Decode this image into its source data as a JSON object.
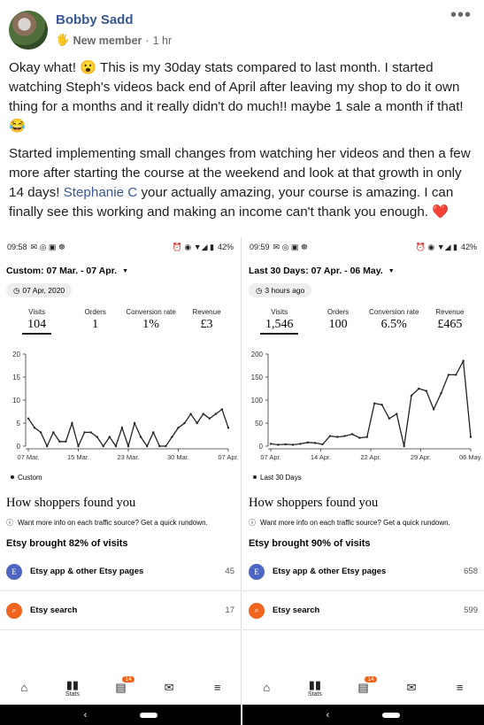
{
  "post": {
    "author": "Bobby Sadd",
    "badge": "New member",
    "separator": "·",
    "time": "1 hr",
    "paragraph1": "Okay what! 😮 This is my 30day stats compared to last month. I started watching Steph's videos back end of April after leaving my shop to do it own thing for a months and it really didn't do much!! maybe 1 sale a month if that! 😂",
    "paragraph2_a": "Started implementing small changes from watching her videos and then a few more after starting the course at the weekend and look at that growth in only 14 days! ",
    "mention": "Stephanie C",
    "paragraph2_b": " your actually amazing, your course is amazing. I can finally see this working and making an income can't thank you enough. ❤️"
  },
  "screens": [
    {
      "status": {
        "time": "09:58",
        "icons_left": "✉ ◎ ▣ ☸",
        "icons_right": "⏰ ◉ ▼◢ ▮",
        "battery": "42%"
      },
      "range": "Custom: 07 Mar. - 07 Apr.",
      "date_pill": "07 Apr, 2020",
      "metrics": [
        {
          "label": "Visits",
          "value": "104"
        },
        {
          "label": "Orders",
          "value": "1"
        },
        {
          "label": "Conversion rate",
          "value": "1%"
        },
        {
          "label": "Revenue",
          "value": "£3"
        }
      ],
      "legend": "Custom",
      "shoppers_title": "How shoppers found you",
      "info": "Want more info on each traffic source? Get a quick rundown.",
      "brought": "Etsy brought 82% of visits",
      "sources": [
        {
          "name": "Etsy app & other Etsy pages",
          "count": "45"
        },
        {
          "name": "Etsy search",
          "count": "17"
        }
      ],
      "nav": {
        "stats_label": "Stats",
        "orders_badge": "14"
      }
    },
    {
      "status": {
        "time": "09:59",
        "icons_left": "✉ ◎ ▣ ☸",
        "icons_right": "⏰ ◉ ▼◢ ▮",
        "battery": "42%"
      },
      "range": "Last 30 Days: 07 Apr. - 06 May.",
      "date_pill": "3 hours ago",
      "metrics": [
        {
          "label": "Visits",
          "value": "1,546"
        },
        {
          "label": "Orders",
          "value": "100"
        },
        {
          "label": "Conversion rate",
          "value": "6.5%"
        },
        {
          "label": "Revenue",
          "value": "£465"
        }
      ],
      "legend": "Last 30 Days",
      "shoppers_title": "How shoppers found you",
      "info": "Want more info on each traffic source? Get a quick rundown.",
      "brought": "Etsy brought 90% of visits",
      "sources": [
        {
          "name": "Etsy app & other Etsy pages",
          "count": "658"
        },
        {
          "name": "Etsy search",
          "count": "599"
        }
      ],
      "nav": {
        "stats_label": "Stats",
        "orders_badge": "14"
      }
    }
  ],
  "chart_data": [
    {
      "type": "line",
      "series_name": "Custom",
      "x_ticks": [
        "07 Mar.",
        "15 Mar.",
        "23 Mar.",
        "30 Mar.",
        "07 Apr."
      ],
      "y_ticks": [
        0,
        5,
        10,
        15,
        20
      ],
      "ylim": [
        0,
        20
      ],
      "values": [
        6,
        4,
        3,
        0,
        3,
        1,
        1,
        5,
        0,
        3,
        3,
        2,
        0,
        2,
        0,
        4,
        0,
        5,
        2,
        0,
        3,
        0,
        0,
        2,
        4,
        5,
        7,
        5,
        7,
        6,
        7,
        8,
        4
      ]
    },
    {
      "type": "line",
      "series_name": "Last 30 Days",
      "x_ticks": [
        "07 Apr.",
        "14 Apr.",
        "22 Apr.",
        "29 Apr.",
        "06 May."
      ],
      "y_ticks": [
        0,
        50,
        100,
        150,
        200
      ],
      "ylim": [
        0,
        200
      ],
      "values": [
        5,
        3,
        4,
        3,
        5,
        8,
        7,
        4,
        22,
        20,
        22,
        26,
        18,
        20,
        93,
        90,
        60,
        70,
        0,
        110,
        125,
        120,
        80,
        115,
        155,
        155,
        185,
        20
      ]
    }
  ]
}
